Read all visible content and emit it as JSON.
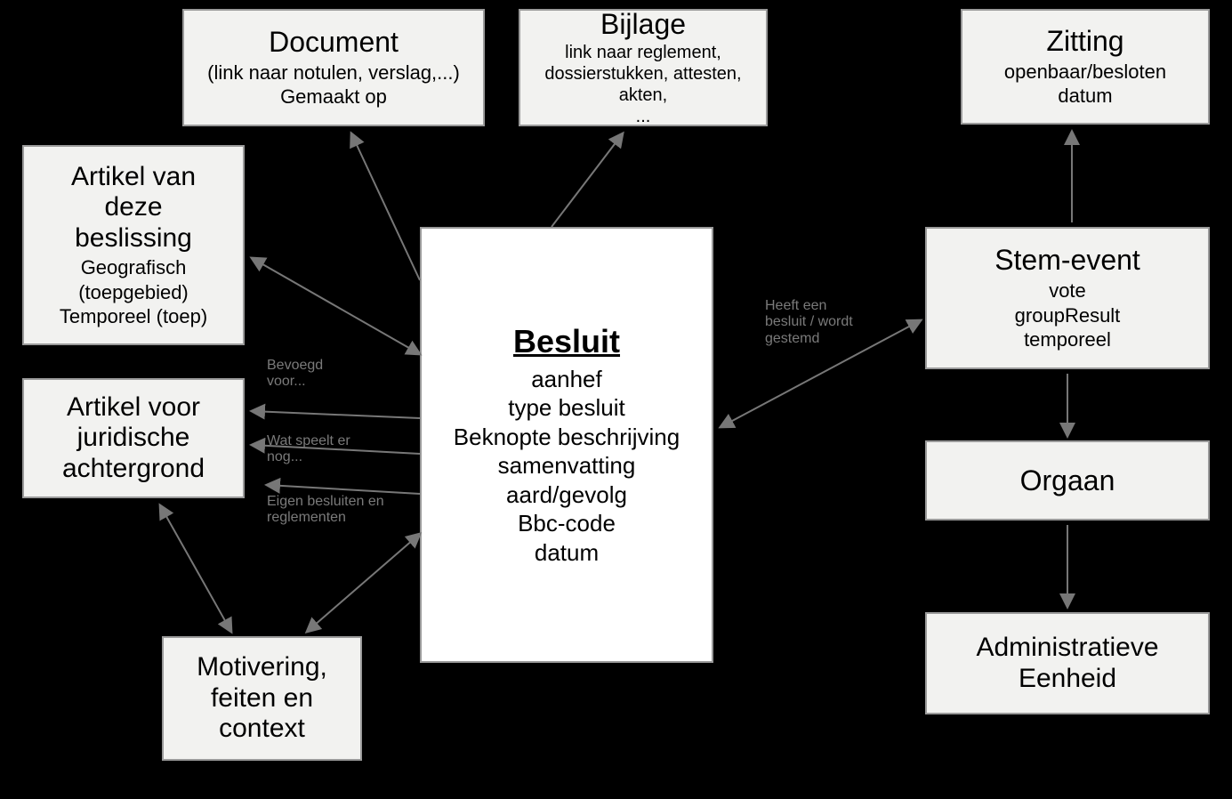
{
  "nodes": {
    "document": {
      "title": "Document",
      "sub": "(link naar notulen, verslag,...)\nGemaakt op"
    },
    "bijlage": {
      "title": "Bijlage",
      "sub": "link naar reglement,\ndossierstukken, attesten, akten,\n..."
    },
    "artikel_beslissing": {
      "title": "Artikel van\ndeze\nbeslissing",
      "sub": "Geografisch\n(toepgebied)\nTemporeel (toep)"
    },
    "artikel_juridisch": {
      "title": "Artikel voor\njuridische\nachtergrond"
    },
    "motivering": {
      "title": "Motivering,\nfeiten en\ncontext"
    },
    "besluit": {
      "title": "Besluit",
      "sub": "aanhef\ntype besluit\nBeknopte beschrijving\nsamenvatting\naard/gevolg\nBbc-code\ndatum"
    },
    "zitting": {
      "title": "Zitting",
      "sub": "openbaar/besloten\ndatum"
    },
    "stem_event": {
      "title": "Stem-event",
      "sub": "vote\ngroupResult\ntemporeel"
    },
    "orgaan": {
      "title": "Orgaan"
    },
    "admin_eenheid": {
      "title": "Administratieve\nEenheid"
    }
  },
  "edge_labels": {
    "bevoegd": "Bevoegd\nvoor...",
    "wat_speelt": "Wat speelt er\nnog...",
    "eigen_besluiten": "Eigen besluiten en\nreglementen",
    "heeft_besluit": "Heeft een\nbesluit / wordt\ngestemd"
  }
}
